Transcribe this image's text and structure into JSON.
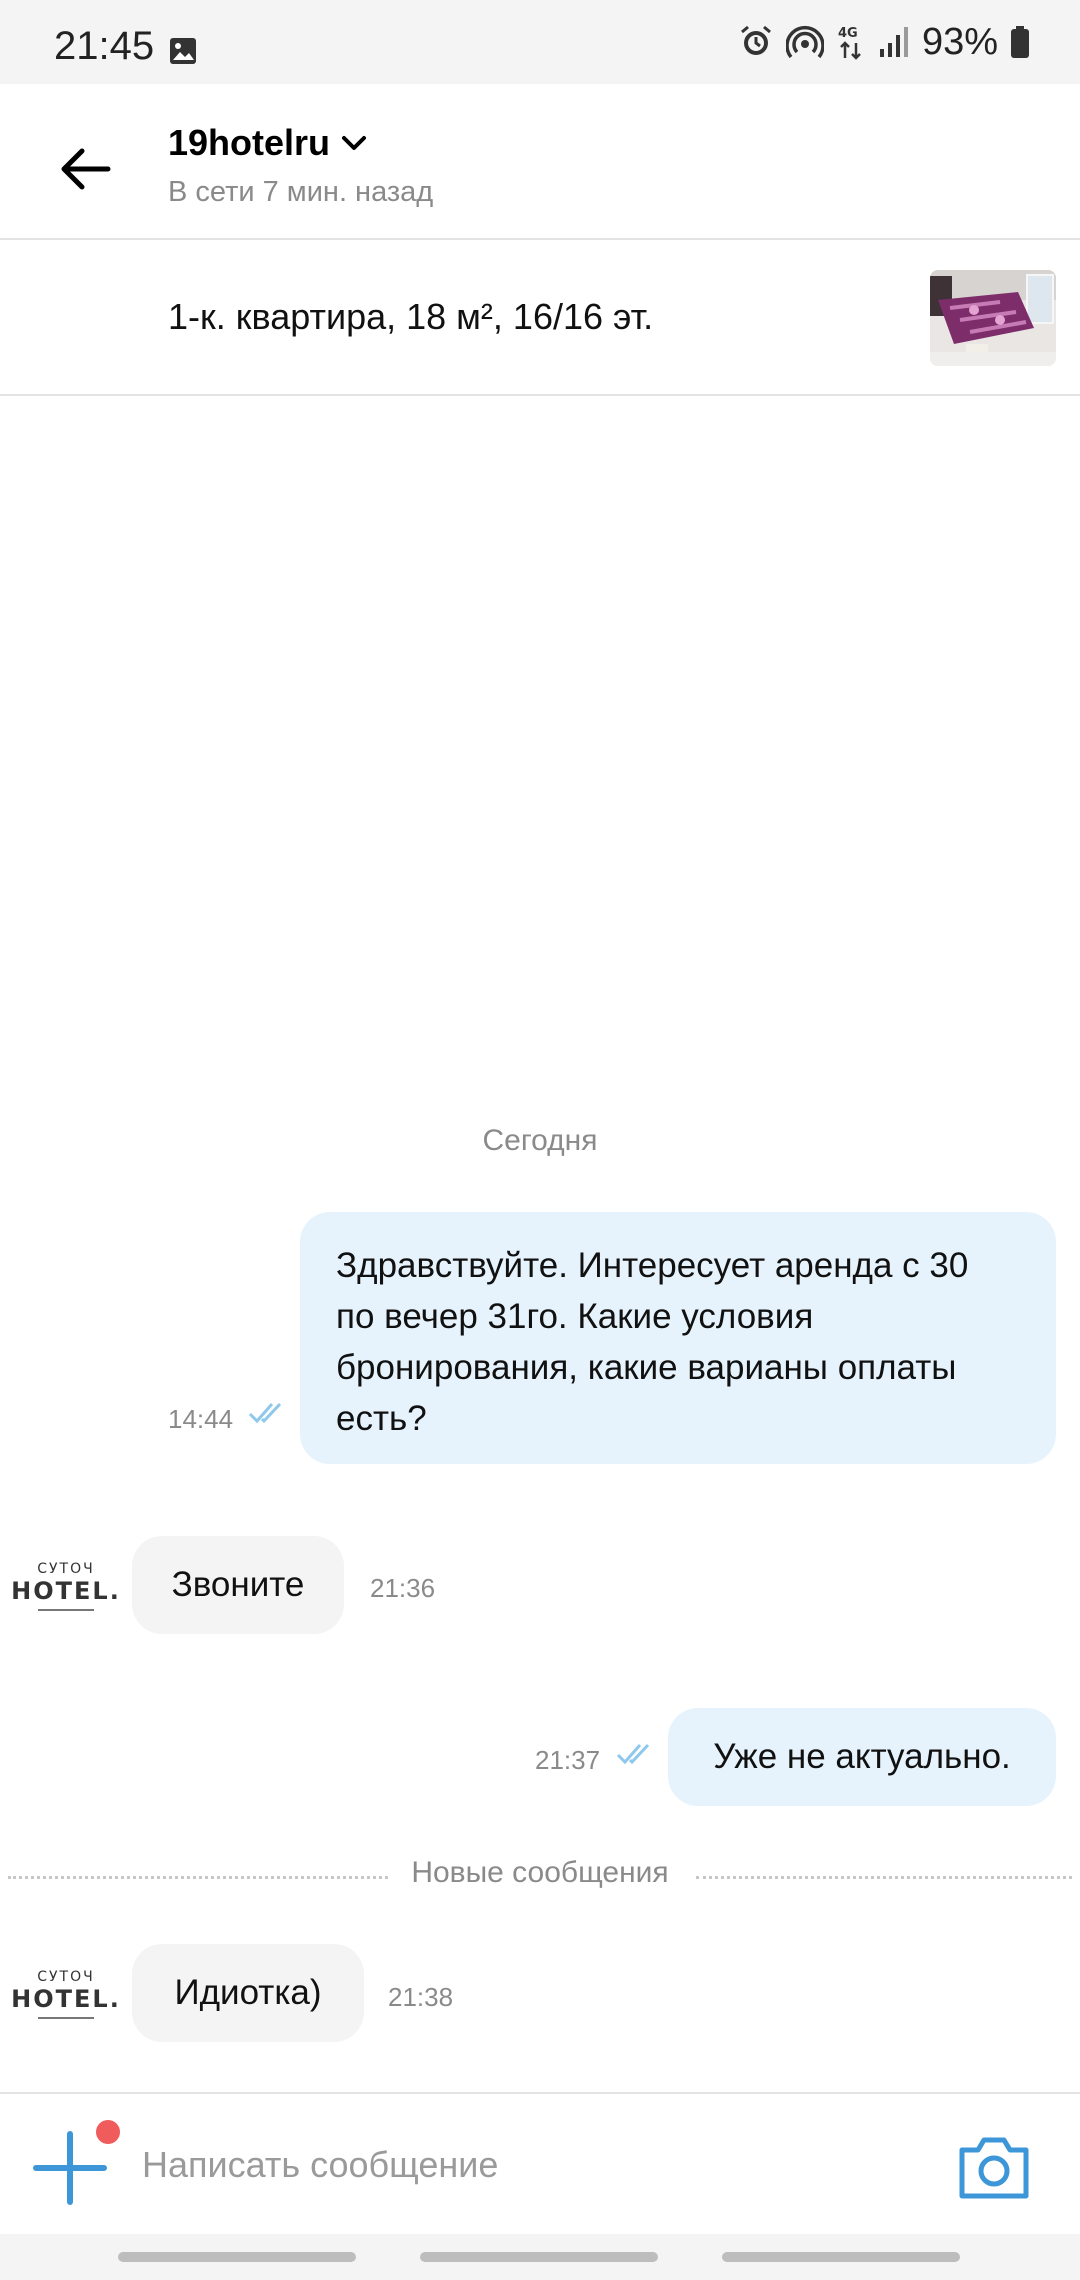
{
  "status_bar": {
    "time": "21:45",
    "battery": "93%",
    "network": "4G",
    "icons": [
      "image-icon",
      "alarm-icon",
      "hotspot-icon",
      "network-4g-icon",
      "signal-icon",
      "battery-icon"
    ]
  },
  "header": {
    "name": "19hotelru",
    "status": "В сети 7 мин. назад"
  },
  "listing": {
    "title": "1-к. квартира, 18 м², 16/16 эт."
  },
  "chat": {
    "date_separator": "Сегодня",
    "new_messages_separator": "Новые сообщения",
    "avatar": {
      "top_text": "СУТОЧ",
      "main_text": "HOTEL."
    },
    "messages": [
      {
        "direction": "out",
        "text": "Здравствуйте. Интересует аренда с 30 по вечер 31го. Какие условия бронирования, какие варианы оплаты есть?",
        "lines": [
          "Здравствуйте. Интересует аренда с 30",
          "по вечер 31го. Какие условия",
          "бронирования, какие варианы оплаты",
          "есть?"
        ],
        "time": "14:44",
        "read": true
      },
      {
        "direction": "in",
        "text": "Звоните",
        "time": "21:36"
      },
      {
        "direction": "out",
        "text": "Уже не актуально.",
        "time": "21:37",
        "read": true
      },
      {
        "direction": "in",
        "text": "Идиотка)",
        "time": "21:38"
      }
    ]
  },
  "input": {
    "placeholder": "Написать сообщение",
    "value": ""
  },
  "colors": {
    "accent": "#3d96d8",
    "bubble_out": "#e6f3fc",
    "bubble_in": "#f4f4f4",
    "read_ticks": "#8ec8ec",
    "notification_dot": "#f05b5b"
  }
}
